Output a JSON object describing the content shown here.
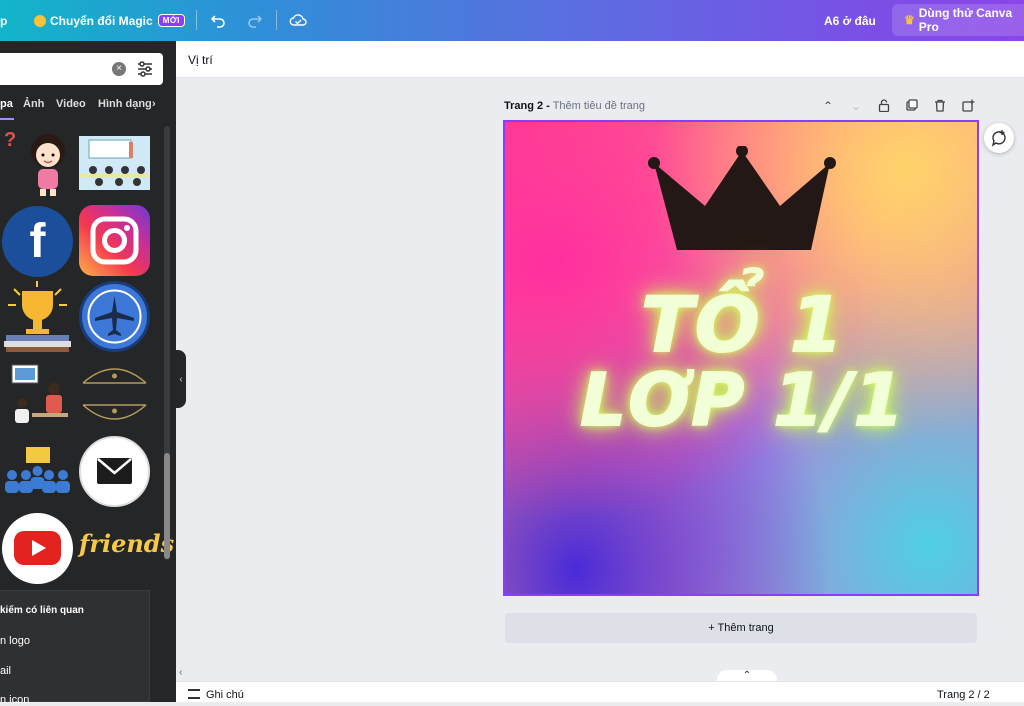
{
  "topbar": {
    "left_text": "p",
    "magic_label": "Chuyển đổi Magic",
    "magic_badge": "MỚI",
    "position_hint": "A6 ở đâu",
    "pro_button": "Dùng thử Canva Pro"
  },
  "sidebar": {
    "tabs": [
      "pa",
      "Ảnh",
      "Video",
      "Hình dạng"
    ],
    "related": {
      "heading": "kiếm có liên quan",
      "items": [
        "n logo",
        "ail",
        "n icon"
      ]
    },
    "grid_items": [
      {
        "name": "question-mark",
        "label": "?"
      },
      {
        "name": "cartoon-girl"
      },
      {
        "name": "classroom"
      },
      {
        "name": "facebook-logo",
        "label": "f"
      },
      {
        "name": "instagram-logo"
      },
      {
        "name": "trophy"
      },
      {
        "name": "airplane-badge"
      },
      {
        "name": "office-workers"
      },
      {
        "name": "ornament-frame"
      },
      {
        "name": "team-meeting"
      },
      {
        "name": "mail-icon"
      },
      {
        "name": "youtube-logo"
      },
      {
        "name": "friends-text",
        "label": "friends"
      }
    ]
  },
  "toolbar": {
    "position_label": "Vị trí"
  },
  "page": {
    "page_label": "Trang 2 -",
    "page_subtitle": "Thêm tiêu đề trang",
    "title_line1": "TỔ 1",
    "title_line2": "LƠP 1/1"
  },
  "add_page_label": "+ Thêm trang",
  "footer": {
    "notes_label": "Ghi chú",
    "page_indicator": "Trang 2 / 2"
  },
  "colors": {
    "accent": "#8b3dff",
    "panel": "#252627"
  }
}
